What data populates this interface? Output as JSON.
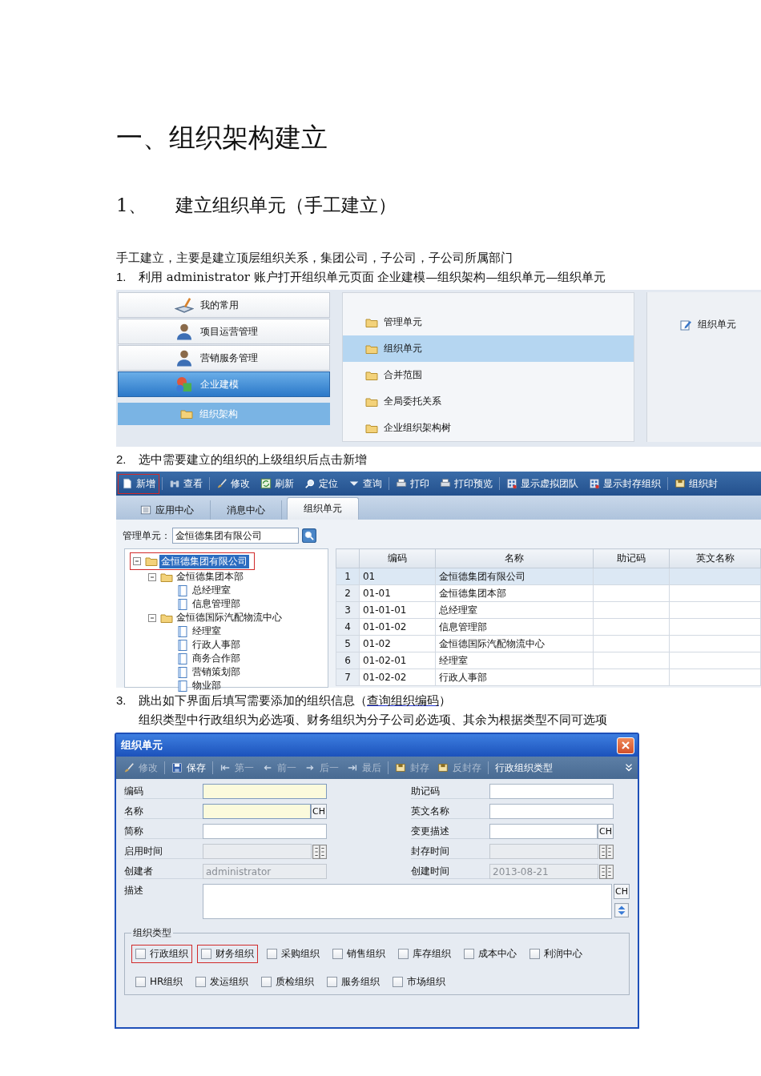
{
  "heading": "一、组织架构建立",
  "subheading": {
    "number": "1、",
    "text": "建立组织单元（手工建立）"
  },
  "intro": "手工建立，主要是建立顶层组织关系，集团公司，子公司，子公司所属部门",
  "step_1": {
    "number": "1.",
    "text": "利用 administrator 账户打开组织单元页面  企业建模—组织架构—组织单元—组织单元"
  },
  "menu_screen": {
    "modules": [
      {
        "label": "我的常用",
        "kind": "book",
        "selected": false
      },
      {
        "label": "项目运营管理",
        "kind": "person",
        "selected": false
      },
      {
        "label": "营销服务管理",
        "kind": "person",
        "selected": false
      },
      {
        "label": "企业建模",
        "kind": "shapes",
        "selected": true
      }
    ],
    "submodule": {
      "label": "组织架构"
    },
    "folders": [
      {
        "label": "管理单元",
        "selected": false
      },
      {
        "label": "组织单元",
        "selected": true
      },
      {
        "label": "合并范围",
        "selected": false
      },
      {
        "label": "全局委托关系",
        "selected": false
      },
      {
        "label": "企业组织架构树",
        "selected": false
      }
    ],
    "functions": [
      {
        "label": "组织单元"
      }
    ]
  },
  "step_2": {
    "number": "2.",
    "text": "选中需要建立的组织的上级组织后点击新增"
  },
  "main_screen": {
    "toolbar": [
      {
        "label": "新增",
        "kind": "new",
        "highlighted": true
      },
      {
        "label": "查看",
        "kind": "view",
        "highlighted": false
      },
      {
        "label": "修改",
        "kind": "brush",
        "highlighted": false
      },
      {
        "label": "刷新",
        "kind": "refresh",
        "highlighted": false
      },
      {
        "label": "定位",
        "kind": "locate",
        "highlighted": false
      },
      {
        "label": "查询",
        "kind": "query",
        "highlighted": false
      },
      {
        "label": "打印",
        "kind": "print",
        "highlighted": false
      },
      {
        "label": "打印预览",
        "kind": "print",
        "highlighted": false
      },
      {
        "label": "显示虚拟团队",
        "kind": "grid",
        "highlighted": false
      },
      {
        "label": "显示封存组织",
        "kind": "grid",
        "highlighted": false
      },
      {
        "label": "组织封",
        "kind": "box",
        "highlighted": false
      }
    ],
    "tabs": [
      {
        "label": "应用中心",
        "selected": false
      },
      {
        "label": "消息中心",
        "selected": false
      },
      {
        "label": "组织单元",
        "selected": true
      }
    ],
    "filter": {
      "label": "管理单元：",
      "value": "金恒德集团有限公司"
    },
    "tree": [
      {
        "label": "金恒德集团有限公司",
        "selected": true,
        "highlighted": true,
        "children": [
          {
            "label": "金恒德集团本部",
            "selected": false,
            "highlighted": false,
            "children": [
              {
                "label": "总经理室",
                "selected": false,
                "highlighted": false
              },
              {
                "label": "信息管理部",
                "selected": false,
                "highlighted": false
              }
            ]
          },
          {
            "label": "金恒德国际汽配物流中心",
            "selected": false,
            "highlighted": false,
            "children": [
              {
                "label": "经理室",
                "selected": false,
                "highlighted": false
              },
              {
                "label": "行政人事部",
                "selected": false,
                "highlighted": false
              },
              {
                "label": "商务合作部",
                "selected": false,
                "highlighted": false
              },
              {
                "label": "营销策划部",
                "selected": false,
                "highlighted": false
              },
              {
                "label": "物业部",
                "selected": false,
                "highlighted": false
              }
            ]
          }
        ]
      }
    ],
    "table": {
      "columns": [
        "编码",
        "名称",
        "助记码",
        "英文名称"
      ],
      "rows": [
        {
          "number": "1",
          "cells": [
            "01",
            "金恒德集团有限公司"
          ],
          "selected": true
        },
        {
          "number": "2",
          "cells": [
            "01-01",
            "金恒德集团本部"
          ],
          "selected": false
        },
        {
          "number": "3",
          "cells": [
            "01-01-01",
            "总经理室"
          ],
          "selected": false
        },
        {
          "number": "4",
          "cells": [
            "01-01-02",
            "信息管理部"
          ],
          "selected": false
        },
        {
          "number": "5",
          "cells": [
            "01-02",
            "金恒德国际汽配物流中心"
          ],
          "selected": false
        },
        {
          "number": "6",
          "cells": [
            "01-02-01",
            "经理室"
          ],
          "selected": false
        },
        {
          "number": "7",
          "cells": [
            "01-02-02",
            "行政人事部"
          ],
          "selected": false
        }
      ]
    }
  },
  "step_3": {
    "number": "3.",
    "text": "跳出如下界面后填写需要添加的组织信息（",
    "link": "查询组织编码",
    "after": "）",
    "note": "组织类型中行政组织为必选项、财务组织为分子公司必选项、其余为根据类型不同可选项"
  },
  "dialog": {
    "title": "组织单元",
    "toolbar": [
      {
        "label": "修改",
        "kind": "brush",
        "disabled": true
      },
      {
        "label": "保存",
        "kind": "save",
        "disabled": false
      },
      {
        "label": "第一",
        "kind": "first",
        "disabled": true
      },
      {
        "label": "前一",
        "kind": "prev",
        "disabled": true
      },
      {
        "label": "后一",
        "kind": "next",
        "disabled": true
      },
      {
        "label": "最后",
        "kind": "last",
        "disabled": true
      },
      {
        "label": "封存",
        "kind": "box",
        "disabled": true
      },
      {
        "label": "反封存",
        "kind": "box",
        "disabled": true
      },
      {
        "label": "行政组织类型",
        "kind": "text",
        "disabled": false
      }
    ],
    "fields": [
      {
        "label": "编码",
        "kind": "text",
        "required": true,
        "disabled": false
      },
      {
        "label": "助记码",
        "kind": "text",
        "required": false,
        "disabled": false
      },
      {
        "label": "名称",
        "kind": "lang",
        "button": "CH",
        "required": true,
        "disabled": false
      },
      {
        "label": "英文名称",
        "kind": "text",
        "required": false,
        "disabled": false
      },
      {
        "label": "简称",
        "kind": "text",
        "required": false,
        "disabled": false
      },
      {
        "label": "变更描述",
        "kind": "lang",
        "button": "CH",
        "required": false,
        "disabled": false
      },
      {
        "label": "启用时间",
        "kind": "date",
        "required": false,
        "disabled": true
      },
      {
        "label": "封存时间",
        "kind": "date",
        "required": false,
        "disabled": true
      },
      {
        "label": "创建者",
        "kind": "text",
        "value": "administrator",
        "required": false,
        "disabled": true
      },
      {
        "label": "创建时间",
        "kind": "date",
        "value": "2013-08-21",
        "required": false,
        "disabled": true
      }
    ],
    "description": {
      "label": "描述",
      "button": "CH"
    },
    "org_types": {
      "label": "组织类型",
      "options": [
        {
          "label": "行政组织",
          "checked": false,
          "highlighted": true
        },
        {
          "label": "财务组织",
          "checked": false,
          "highlighted": true
        },
        {
          "label": "采购组织",
          "checked": false,
          "highlighted": false
        },
        {
          "label": "销售组织",
          "checked": false,
          "highlighted": false
        },
        {
          "label": "库存组织",
          "checked": false,
          "highlighted": false
        },
        {
          "label": "成本中心",
          "checked": false,
          "highlighted": false
        },
        {
          "label": "利润中心",
          "checked": false,
          "highlighted": false
        },
        {
          "label": "HR组织",
          "checked": false,
          "highlighted": false
        },
        {
          "label": "发运组织",
          "checked": false,
          "highlighted": false
        },
        {
          "label": "质检组织",
          "checked": false,
          "highlighted": false
        },
        {
          "label": "服务组织",
          "checked": false,
          "highlighted": false
        },
        {
          "label": "市场组织",
          "checked": false,
          "highlighted": false
        }
      ]
    }
  }
}
